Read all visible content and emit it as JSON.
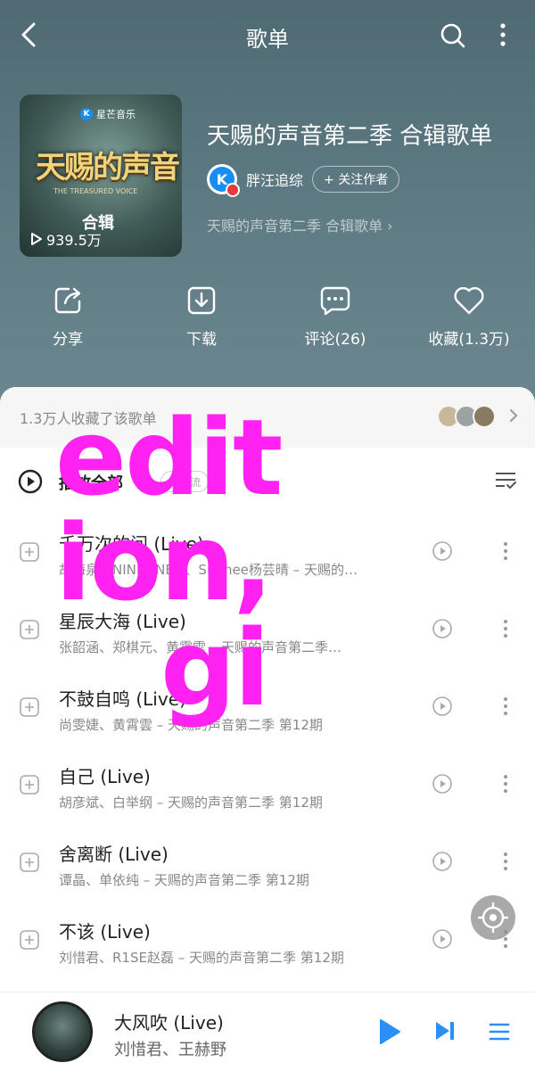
{
  "header": {
    "title": "歌单"
  },
  "playlist": {
    "cover": {
      "brand": "星芒音乐",
      "brand_letter": "K",
      "show_title": "天赐的声音",
      "show_subtitle_en": "THE TREASURED VOICE",
      "label": "合辑",
      "play_count": "939.5万"
    },
    "title": "天赐的声音第二季 合辑歌单",
    "author": {
      "avatar_letter": "K",
      "name": "胖汪追综",
      "follow_label": "+ 关注作者"
    },
    "description": "天赐的声音第二季 合辑歌单 ›"
  },
  "actions": [
    {
      "label": "分享",
      "icon": "share-icon"
    },
    {
      "label": "下载",
      "icon": "download-icon"
    },
    {
      "label": "评论(26)",
      "icon": "comment-icon"
    },
    {
      "label": "收藏(1.3万)",
      "icon": "heart-icon"
    }
  ],
  "favorites": {
    "text": "1.3万人收藏了该歌单"
  },
  "play_all": {
    "label": "播放全部",
    "badge": "⚡ 免流"
  },
  "songs": [
    {
      "name": "千万次的问 (Live)",
      "meta": "胡海泉、NINEONE#、Sunnee杨芸晴 – 天赐的…"
    },
    {
      "name": "星辰大海 (Live)",
      "meta": "张韶涵、郑棋元、黄霄雲 – 天赐的声音第二季…"
    },
    {
      "name": "不鼓自鸣 (Live)",
      "meta": "尚雯婕、黄霄雲 – 天赐的声音第二季 第12期"
    },
    {
      "name": "自己 (Live)",
      "meta": "胡彦斌、白举纲 – 天赐的声音第二季 第12期"
    },
    {
      "name": "舍离断 (Live)",
      "meta": "谭晶、单依纯 – 天赐的声音第二季 第12期"
    },
    {
      "name": "不该 (Live)",
      "meta": "刘惜君、R1SE赵磊 – 天赐的声音第二季 第12期"
    }
  ],
  "watermark": {
    "line1": "edit",
    "line2": "ion,",
    "line3": "gi"
  },
  "mini_player": {
    "title": "大风吹 (Live)",
    "artist": "刘惜君、王赫野"
  },
  "colors": {
    "accent": "#2a8ff7",
    "header_bg": "#5e7a83",
    "watermark": "#ff22f0"
  }
}
